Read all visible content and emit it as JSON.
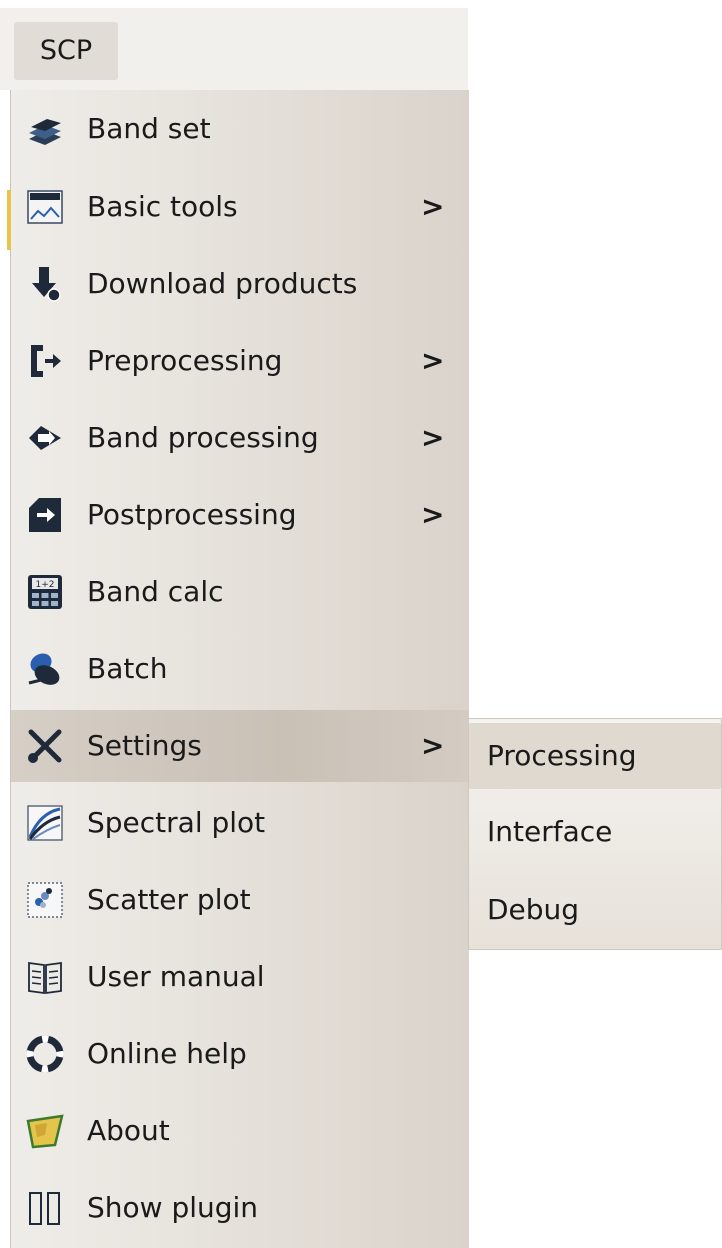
{
  "menubar": {
    "title": "SCP"
  },
  "menu": {
    "items": [
      {
        "label": "Band set",
        "icon": "band-set-icon",
        "has_submenu": false
      },
      {
        "label": "Basic tools",
        "icon": "basic-tools-icon",
        "has_submenu": true
      },
      {
        "label": "Download products",
        "icon": "download-icon",
        "has_submenu": false
      },
      {
        "label": "Preprocessing",
        "icon": "preprocessing-icon",
        "has_submenu": true
      },
      {
        "label": "Band processing",
        "icon": "band-processing-icon",
        "has_submenu": true
      },
      {
        "label": "Postprocessing",
        "icon": "postprocessing-icon",
        "has_submenu": true
      },
      {
        "label": "Band calc",
        "icon": "calculator-icon",
        "has_submenu": false
      },
      {
        "label": "Batch",
        "icon": "batch-icon",
        "has_submenu": false
      },
      {
        "label": "Settings",
        "icon": "settings-tools-icon",
        "has_submenu": true,
        "highlighted": true
      },
      {
        "label": "Spectral plot",
        "icon": "spectral-plot-icon",
        "has_submenu": false
      },
      {
        "label": "Scatter plot",
        "icon": "scatter-plot-icon",
        "has_submenu": false
      },
      {
        "label": "User manual",
        "icon": "manual-book-icon",
        "has_submenu": false
      },
      {
        "label": "Online help",
        "icon": "help-lifebuoy-icon",
        "has_submenu": false
      },
      {
        "label": "About",
        "icon": "about-map-icon",
        "has_submenu": false
      },
      {
        "label": "Show plugin",
        "icon": "show-plugin-icon",
        "has_submenu": false
      }
    ],
    "submenu_arrow": ">"
  },
  "settings_submenu": {
    "items": [
      {
        "label": "Processing",
        "highlighted": true
      },
      {
        "label": "Interface"
      },
      {
        "label": "Debug"
      }
    ]
  },
  "colors": {
    "accent_dark": "#1e2a3a",
    "accent_blue": "#2a5fb0",
    "highlight_bg": "#cfc6bc"
  }
}
